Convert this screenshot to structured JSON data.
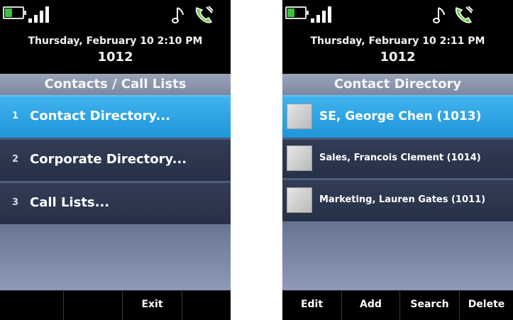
{
  "colors": {
    "accent_selected": "#2ba5e8",
    "title_bar": "#8b95ab",
    "row_dark": "#2b3549",
    "battery_green": "#3ec23e",
    "phone_icon_green": "#6fd04a"
  },
  "left_screen": {
    "status": {
      "battery_icon": "battery-icon",
      "signal_icon": "signal-bars-icon",
      "ringtone_icon": "music-note-icon",
      "handset_icon": "handset-icon"
    },
    "datetime": "Thursday, February 10 2:10 PM",
    "extension": "1012",
    "title": "Contacts / Call Lists",
    "menu": [
      {
        "number": "1",
        "label": "Contact Directory...",
        "selected": true
      },
      {
        "number": "2",
        "label": "Corporate Directory...",
        "selected": false
      },
      {
        "number": "3",
        "label": "Call Lists...",
        "selected": false
      }
    ],
    "softkeys": [
      "",
      "",
      "Exit",
      ""
    ]
  },
  "right_screen": {
    "status": {
      "battery_icon": "battery-icon",
      "signal_icon": "signal-bars-icon",
      "ringtone_icon": "music-note-icon",
      "handset_icon": "handset-icon"
    },
    "datetime": "Thursday, February 10 2:11 PM",
    "extension": "1012",
    "title": "Contact Directory",
    "contacts": [
      {
        "name": "SE, George Chen (1013)",
        "selected": true
      },
      {
        "name": "Sales, Francois Clement (1014)",
        "selected": false
      },
      {
        "name": "Marketing, Lauren Gates (1011)",
        "selected": false
      }
    ],
    "softkeys": [
      "Edit",
      "Add",
      "Search",
      "Delete"
    ]
  }
}
